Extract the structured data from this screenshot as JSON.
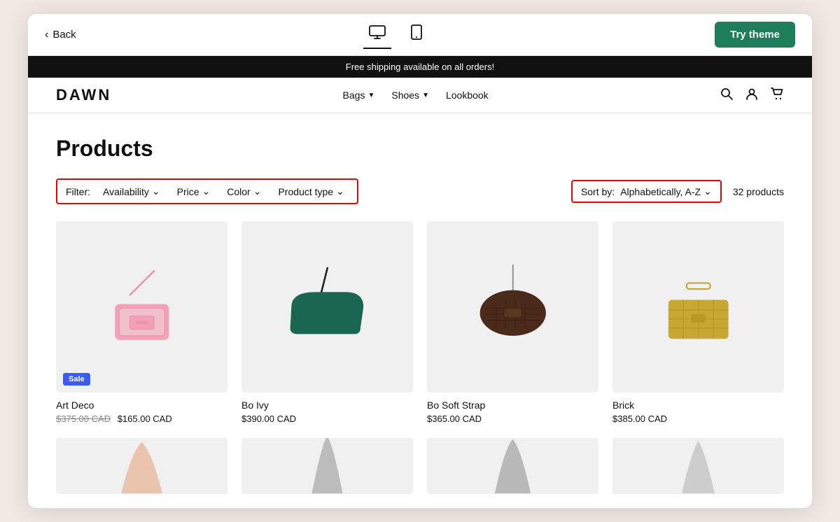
{
  "topBar": {
    "back_label": "Back",
    "try_theme_label": "Try theme",
    "device_desktop": "Desktop",
    "device_tablet": "Tablet"
  },
  "announcement": {
    "text": "Free shipping available on all orders!"
  },
  "storeNav": {
    "logo": "DAWN",
    "links": [
      {
        "label": "Bags"
      },
      {
        "label": "Shoes"
      },
      {
        "label": "Lookbook"
      }
    ]
  },
  "mainContent": {
    "page_title": "Products",
    "filter_label": "Filter:",
    "filters": [
      {
        "label": "Availability"
      },
      {
        "label": "Price"
      },
      {
        "label": "Color"
      },
      {
        "label": "Product type"
      }
    ],
    "sort_label": "Sort by:",
    "sort_value": "Alphabetically, A-Z",
    "products_count": "32 products",
    "products": [
      {
        "name": "Art Deco",
        "price": "$165.00 CAD",
        "original_price": "$375.00 CAD",
        "sale": true,
        "color": "#e8a0b4"
      },
      {
        "name": "Bo Ivy",
        "price": "$390.00 CAD",
        "original_price": null,
        "sale": false,
        "color": "#1a6650"
      },
      {
        "name": "Bo Soft Strap",
        "price": "$365.00 CAD",
        "original_price": null,
        "sale": false,
        "color": "#4a2a1a"
      },
      {
        "name": "Brick",
        "price": "$385.00 CAD",
        "original_price": null,
        "sale": false,
        "color": "#c8a832"
      }
    ],
    "partial_row_colors": [
      "#e8b090",
      "#888",
      "#666",
      "#999"
    ]
  }
}
